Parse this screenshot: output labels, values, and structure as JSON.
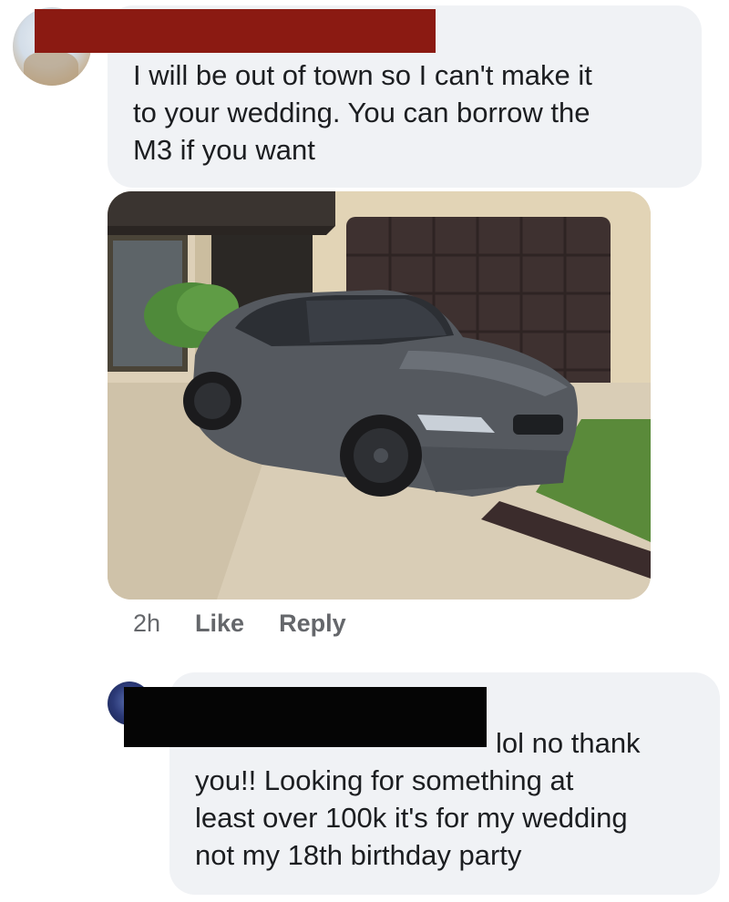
{
  "comment_1": {
    "text": "I will be out of town so I can't make it\nto your wedding. You can borrow the\nM3 if you want",
    "attachment_icon": "car-photo",
    "meta": {
      "time": "2h",
      "like_label": "Like",
      "reply_label": "Reply"
    }
  },
  "comment_2": {
    "text": "lol no thank\nyou!! Looking for something at\nleast over 100k it's for my wedding\nnot my 18th birthday party"
  },
  "colors": {
    "bubble": "#f0f2f5",
    "redaction_red": "#8b1a12",
    "redaction_black": "#050505",
    "meta_text": "#65676b"
  }
}
